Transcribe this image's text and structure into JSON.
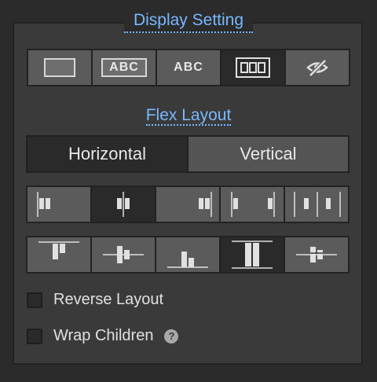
{
  "section_title": "Display Setting",
  "display_options": [
    {
      "name": "block",
      "label": ""
    },
    {
      "name": "inline-block",
      "label": "ABC"
    },
    {
      "name": "inline",
      "label": "ABC"
    },
    {
      "name": "flex",
      "label": "",
      "active": true
    },
    {
      "name": "none",
      "label": ""
    }
  ],
  "flex_title": "Flex Layout",
  "direction": {
    "horizontal": "Horizontal",
    "vertical": "Vertical",
    "selected": "Horizontal"
  },
  "justify_options": [
    "start",
    "center",
    "end",
    "space-between",
    "space-around"
  ],
  "justify_selected": "center",
  "align_options": [
    "top",
    "center",
    "bottom",
    "stretch",
    "baseline"
  ],
  "align_selected": "stretch",
  "reverse_label": "Reverse Layout",
  "wrap_label": "Wrap Children",
  "help_glyph": "?",
  "accent_color": "#79b8ff"
}
